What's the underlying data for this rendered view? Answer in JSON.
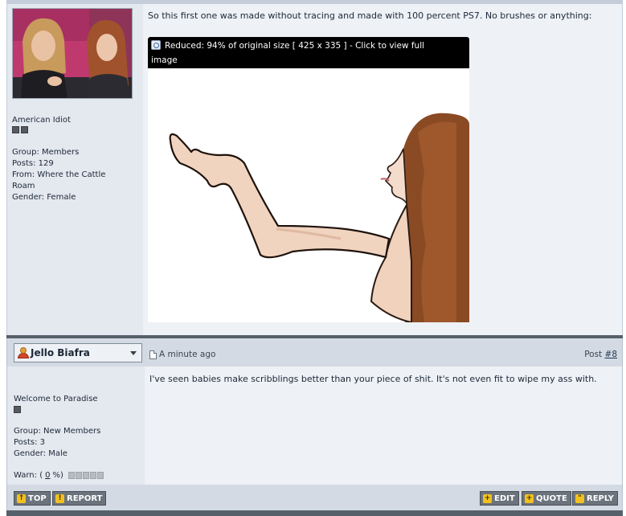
{
  "post1": {
    "author_title": "American Idiot",
    "rank_pips": 2,
    "info": [
      "Group: Members",
      "Posts: 129",
      "From: Where the Cattle",
      "Roam",
      "Gender: Female"
    ],
    "text": "So this first one was made without tracing and made with 100 percent PS7. No brushes or anything:",
    "image_notice_line1": "Reduced: 94% of original size [ 425 x 335 ] - Click to view full",
    "image_notice_line2": "image"
  },
  "post2": {
    "author": "Jello Biafra",
    "time": "A minute ago",
    "post_label": "Post",
    "post_number": "#8",
    "author_title": "Welcome to Paradise",
    "rank_pips": 1,
    "info": [
      "Group: New Members",
      "Posts: 3",
      "Gender: Male"
    ],
    "warn_label": "Warn: (",
    "warn_value": "0",
    "warn_suffix": "%)",
    "warn_level": 0,
    "text": "I've seen babies make scribblings better than your piece of shit. It's not even fit to wipe my ass with."
  },
  "buttons": {
    "top": "TOP",
    "report": "REPORT",
    "edit": "EDIT",
    "quote": "QUOTE",
    "reply": "REPLY"
  },
  "icons": {
    "top": "arrow-up-icon",
    "report": "exclamation-icon",
    "edit": "plus-icon",
    "quote": "plus-icon",
    "reply": "quote-marks-icon"
  },
  "colors": {
    "accent_button": "#6b737c",
    "icon_badge": "#f2c11d",
    "header_bar": "#d3dae3",
    "post_body": "#eef1f5",
    "sidebar": "#e4e8ef"
  }
}
